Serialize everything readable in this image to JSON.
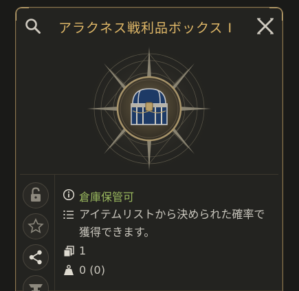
{
  "header": {
    "title": "アラクネス戦利品ボックス I",
    "search_icon": "search-icon",
    "close_icon": "close-icon"
  },
  "item": {
    "icon": "treasure-chest-icon",
    "storage_text": "倉庫保管可",
    "description": "アイテムリストから決められた確率で獲得できます。",
    "count": "1",
    "weight": "0 (0)"
  },
  "sidebar": {
    "buttons": [
      "lock-icon",
      "star-icon",
      "share-icon",
      "anvil-icon"
    ]
  },
  "colors": {
    "title": "#e0b868",
    "storage": "#9ab85e",
    "text": "#c9c6bd",
    "frame": "#c9ad74"
  }
}
